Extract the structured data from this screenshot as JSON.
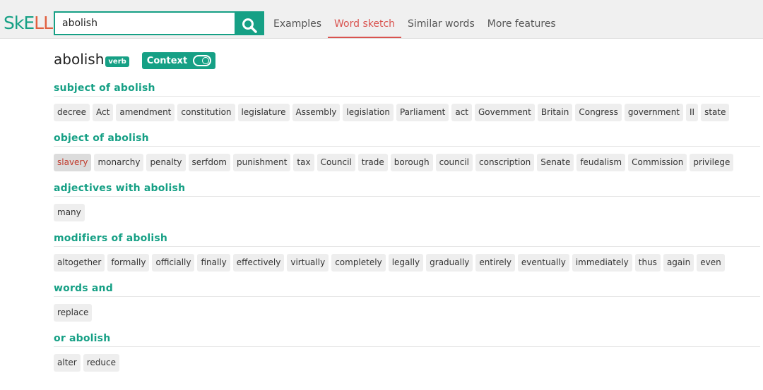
{
  "logo": {
    "part1": "SkE",
    "part2": "LL"
  },
  "search": {
    "value": "abolish"
  },
  "nav": [
    {
      "label": "Examples",
      "active": false
    },
    {
      "label": "Word sketch",
      "active": true
    },
    {
      "label": "Similar words",
      "active": false
    },
    {
      "label": "More features",
      "active": false
    }
  ],
  "headword": {
    "word": "abolish",
    "pos": "verb",
    "context_label": "Context"
  },
  "sections": [
    {
      "title": "subject of abolish",
      "items": [
        "decree",
        "Act",
        "amendment",
        "constitution",
        "legislature",
        "Assembly",
        "legislation",
        "Parliament",
        "act",
        "Government",
        "Britain",
        "Congress",
        "government",
        "II",
        "state"
      ]
    },
    {
      "title": "object of abolish",
      "items": [
        "slavery",
        "monarchy",
        "penalty",
        "serfdom",
        "punishment",
        "tax",
        "Council",
        "trade",
        "borough",
        "council",
        "conscription",
        "Senate",
        "feudalism",
        "Commission",
        "privilege"
      ],
      "selected_index": 0
    },
    {
      "title": "adjectives with abolish",
      "items": [
        "many"
      ]
    },
    {
      "title": "modifiers of abolish",
      "items": [
        "altogether",
        "formally",
        "officially",
        "finally",
        "effectively",
        "virtually",
        "completely",
        "legally",
        "gradually",
        "entirely",
        "eventually",
        "immediately",
        "thus",
        "again",
        "even"
      ]
    },
    {
      "title": "words and",
      "items": [
        "replace"
      ]
    },
    {
      "title": "or abolish",
      "items": [
        "alter",
        "reduce"
      ]
    }
  ],
  "colors": {
    "accent": "#16a085",
    "active_tab": "#d9534f",
    "selected_chip_text": "#c0392b"
  }
}
